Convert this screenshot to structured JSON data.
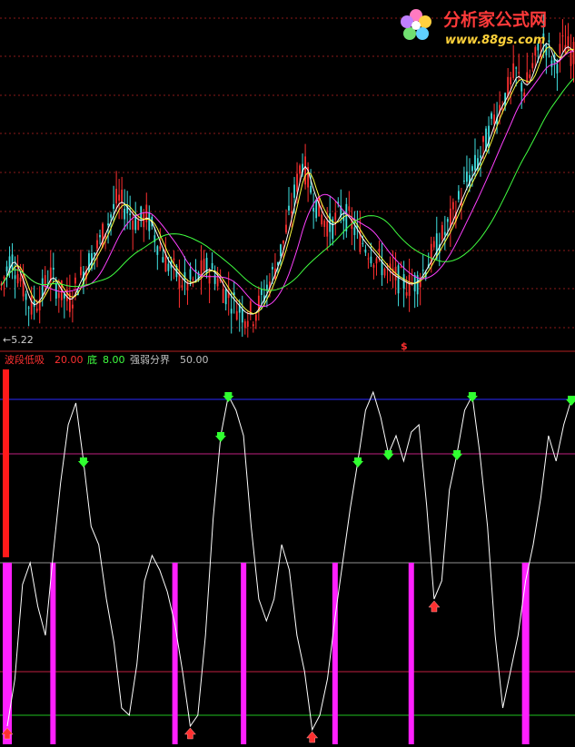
{
  "watermark": {
    "title": "分析家公式网",
    "url": "www.88gs.com"
  },
  "price_panel": {
    "low_label": "←5.22",
    "signal_marker": "$",
    "colors": {
      "up": "#ff3030",
      "down": "#40e0e0",
      "ma_fast": "#ffffff",
      "ma_mid": "#ffff40",
      "ma_slow": "#ff40ff",
      "ma_long": "#40ff40",
      "grid": "#8b1a1a"
    }
  },
  "indicator_panel": {
    "legend": [
      {
        "name": "波段低吸",
        "value": "20.00",
        "color": "#ff3030"
      },
      {
        "name": "底",
        "value": "8.00",
        "color": "#40ff40"
      },
      {
        "name": "强弱分界",
        "value": "50.00",
        "color": "#c0c0c0"
      }
    ]
  },
  "chart_data": {
    "type": "line",
    "title": "",
    "price": {
      "low_label_value": 5.22,
      "close_path": [
        5.8,
        6.3,
        5.9,
        5.4,
        5.6,
        6.0,
        5.7,
        5.5,
        5.9,
        6.2,
        6.5,
        6.9,
        7.3,
        7.1,
        6.9,
        7.0,
        6.6,
        6.2,
        6.0,
        5.8,
        5.9,
        6.1,
        6.0,
        5.7,
        5.5,
        5.3,
        5.3,
        5.6,
        6.0,
        6.5,
        7.2,
        8.0,
        7.4,
        7.0,
        6.8,
        7.1,
        6.9,
        6.6,
        6.4,
        6.2,
        6.0,
        5.9,
        5.8,
        5.9,
        6.2,
        6.5,
        6.8,
        7.2,
        7.6,
        7.9,
        8.3,
        8.8,
        9.1,
        9.5,
        9.2,
        9.7,
        10.1,
        9.6,
        10.0,
        9.8
      ]
    },
    "indicator": {
      "ylim": [
        0,
        100
      ],
      "levels": {
        "top": 95,
        "upper": 80,
        "mid": 50,
        "low": 20,
        "bottom": 8
      },
      "series": [
        {
          "values": [
            5,
            18,
            44,
            50,
            38,
            30,
            52,
            72,
            88,
            94,
            78,
            60,
            55,
            40,
            28,
            10,
            8,
            22,
            45,
            52,
            48,
            42,
            33,
            20,
            5,
            8,
            30,
            62,
            85,
            96,
            92,
            85,
            60,
            40,
            34,
            40,
            55,
            48,
            30,
            20,
            4,
            8,
            18,
            35,
            50,
            65,
            78,
            92,
            97,
            90,
            80,
            85,
            78,
            86,
            88,
            66,
            40,
            45,
            70,
            80,
            92,
            96,
            80,
            60,
            30,
            10,
            20,
            30,
            45,
            55,
            68,
            85,
            78,
            88,
            95
          ]
        }
      ],
      "bottom_bars_at": [
        0,
        6,
        22,
        31,
        43,
        53,
        68
      ],
      "sell_arrows_at": [
        10,
        28,
        29,
        46,
        50,
        59,
        61,
        74
      ],
      "buy_arrows_at": [
        0,
        24,
        40,
        56
      ]
    }
  }
}
